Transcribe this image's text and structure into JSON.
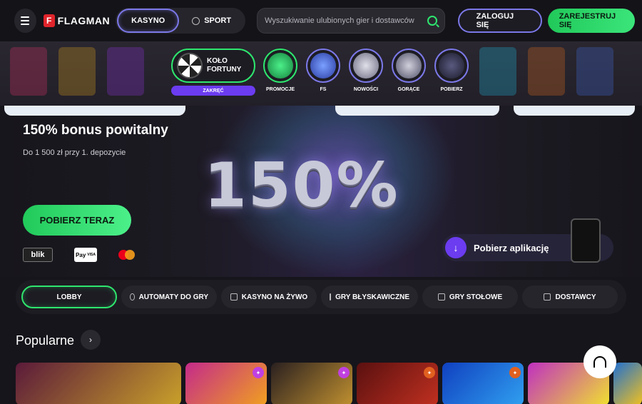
{
  "header": {
    "logo_text": "FLAGMAN",
    "logo_mark": "F",
    "tabs": [
      {
        "label": "KASYNO",
        "active": true
      },
      {
        "label": "SPORT",
        "active": false
      }
    ],
    "search": {
      "placeholder": "Wyszukiwanie ulubionych gier i dostawców"
    },
    "login_label": "ZALOGUJ SIĘ",
    "register_label": "ZAREJESTRUJ SIĘ"
  },
  "promo": {
    "wheel": {
      "label_line1": "KOŁO",
      "label_line2": "FORTUNY",
      "spin_label": "ZAKRĘĆ"
    },
    "items": [
      {
        "label": "PROMOCJE",
        "icon": "gift-icon",
        "color": "#2ee66e"
      },
      {
        "label": "FS",
        "icon": "goggles-icon",
        "color": "#5b6ef0"
      },
      {
        "label": "NOWOŚCI",
        "icon": "gamepad-icon",
        "color": "#c0c0d0"
      },
      {
        "label": "GORĄCE",
        "icon": "rocket-icon",
        "color": "#b0b0c0"
      },
      {
        "label": "POBIERZ",
        "icon": "phone-icon",
        "color": "#3a3a55"
      }
    ]
  },
  "hero": {
    "title": "150% bonus powitalny",
    "subtitle": "Do 1 500 zł przy 1. depozycie",
    "big_text": "150%",
    "cta_label": "POBIERZ TERAZ",
    "payments": {
      "blik": "blik",
      "apple_pay": "Pay",
      "apple_pay_sub": "VISA"
    },
    "app_label": "Pobierz aplikację"
  },
  "categories": [
    {
      "label": "LOBBY",
      "icon": "",
      "active": true
    },
    {
      "label": "AUTOMATY DO GRY",
      "icon": "slot-icon",
      "active": false
    },
    {
      "label": "KASYNO NA ŻYWO",
      "icon": "live-icon",
      "active": false
    },
    {
      "label": "GRY BŁYSKAWICZNE",
      "icon": "chart-icon",
      "active": false
    },
    {
      "label": "GRY STOŁOWE",
      "icon": "dice-icon",
      "active": false
    },
    {
      "label": "DOSTAWCY",
      "icon": "grid-icon",
      "active": false
    }
  ],
  "popular": {
    "title": "Popularne",
    "games": [
      {
        "colors": [
          "#5a1a3a",
          "#c9a02a"
        ],
        "badge": false
      },
      {
        "colors": [
          "#c42a8a",
          "#f0a020"
        ],
        "badge": true,
        "badge_color": "#c040e0"
      },
      {
        "colors": [
          "#2a2020",
          "#c09030"
        ],
        "badge": true,
        "badge_color": "#c040e0"
      },
      {
        "colors": [
          "#5a1010",
          "#c03020"
        ],
        "badge": true,
        "badge_color": "#e06020"
      },
      {
        "colors": [
          "#1040c0",
          "#30a0f0"
        ],
        "badge": true,
        "badge_color": "#e06020"
      },
      {
        "colors": [
          "#c030c0",
          "#f0e030"
        ],
        "badge": false
      },
      {
        "colors": [
          "#2070d0",
          "#f0c020"
        ],
        "badge": false
      }
    ]
  },
  "colors": {
    "accent_green": "#2ee66e",
    "accent_purple": "#7b78e8",
    "spin_purple": "#6b3cf0"
  }
}
